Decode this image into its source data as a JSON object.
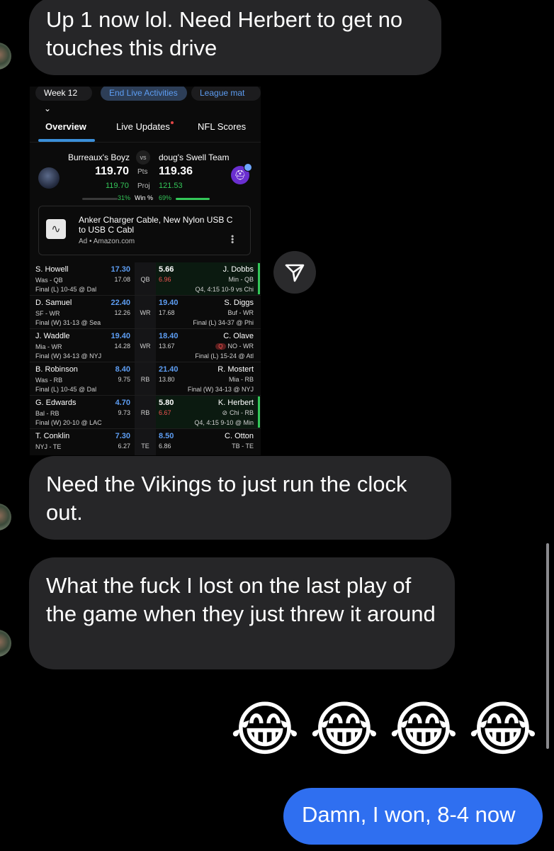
{
  "messages": {
    "m1": "Up 1 now lol. Need Herbert to get no touches this drive",
    "m2": "Need the Vikings to just run the clock out.",
    "m3": "What the fuck I lost on the last play of the game when they just threw it around",
    "emoji": [
      "😂",
      "😂",
      "😂",
      "😂"
    ],
    "out": "Damn, I won, 8-4 now"
  },
  "shot": {
    "week_label": "Week 12",
    "end_live": "End Live Activities",
    "league": "League mat",
    "tabs": [
      "Overview",
      "Live Updates",
      "NFL Scores"
    ],
    "team_left": "Burreaux's Boyz",
    "team_right": "doug's Swell Team",
    "vs": "vs",
    "score_left": "119.70",
    "score_right": "119.36",
    "pts_label": "Pts",
    "proj_left": "119.70",
    "proj_right": "121.53",
    "proj_label": "Proj",
    "win_left": "31%",
    "win_right": "69%",
    "win_label": "Win %",
    "ad_title": "Anker Charger Cable, New Nylon USB C to USB C Cabl",
    "ad_sub": "Ad • Amazon.com",
    "rows": [
      {
        "lname": "S. Howell",
        "lpos": "Was - QB",
        "lgame": "Final (L) 10-45 @ Dal",
        "lpts": "17.30",
        "lproj": "17.08",
        "pos": "QB",
        "rpts": "5.66",
        "rproj": "6.96",
        "rname": "J. Dobbs",
        "rpos": "Min - QB",
        "rgame": "Q4, 4:15 10-9 vs Chi"
      },
      {
        "lname": "D. Samuel",
        "lpos": "SF - WR",
        "lgame": "Final (W) 31-13 @ Sea",
        "lpts": "22.40",
        "lproj": "12.26",
        "pos": "WR",
        "rpts": "19.40",
        "rproj": "17.68",
        "rname": "S. Diggs",
        "rpos": "Buf - WR",
        "rgame": "Final (L) 34-37 @ Phi"
      },
      {
        "lname": "J. Waddle",
        "lpos": "Mia - WR",
        "lgame": "Final (W) 34-13 @ NYJ",
        "lpts": "19.40",
        "lproj": "14.28",
        "pos": "WR",
        "rpts": "18.40",
        "rproj": "13.67",
        "rname": "C. Olave",
        "rpos": "NO - WR",
        "rbadge": "Q",
        "rgame": "Final (L) 15-24 @ Atl"
      },
      {
        "lname": "B. Robinson",
        "lpos": "Was - RB",
        "lgame": "Final (L) 10-45 @ Dal",
        "lpts": "8.40",
        "lproj": "9.75",
        "pos": "RB",
        "rpts": "21.40",
        "rproj": "13.80",
        "rname": "R. Mostert",
        "rpos": "Mia - RB",
        "rgame": "Final (W) 34-13 @ NYJ"
      },
      {
        "lname": "G. Edwards",
        "lpos": "Bal - RB",
        "lgame": "Final (W) 20-10 @ LAC",
        "lpts": "4.70",
        "lproj": "9.73",
        "pos": "RB",
        "rpts": "5.80",
        "rproj": "6.67",
        "rname": "K. Herbert",
        "rpos": "Chi - RB",
        "rgame": "Q4, 4:15 9-10 @ Min"
      },
      {
        "lname": "T. Conklin",
        "lpos": "NYJ - TE",
        "lgame": "",
        "lpts": "7.30",
        "lproj": "6.27",
        "pos": "TE",
        "rpts": "8.50",
        "rproj": "6.86",
        "rname": "C. Otton",
        "rpos": "TB - TE",
        "rgame": ""
      }
    ]
  }
}
